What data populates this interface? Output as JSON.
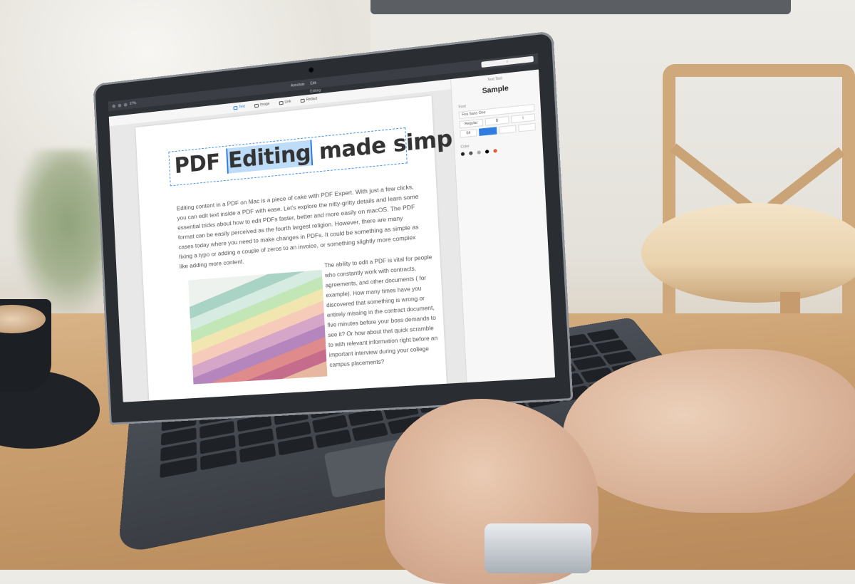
{
  "app": {
    "titlebar": {
      "zoom": "27%",
      "center_items": [
        "Annotate",
        "Edit"
      ],
      "search_placeholder": ""
    },
    "document_title": "Editing",
    "toolbar": {
      "tools": [
        {
          "label": "Text",
          "active": true
        },
        {
          "label": "Image",
          "active": false
        },
        {
          "label": "Link",
          "active": false
        },
        {
          "label": "Redact",
          "active": false
        }
      ]
    },
    "page": {
      "headline_before": "PDF ",
      "headline_selected": "Editing",
      "headline_after": " made simple",
      "body": "Editing content in a PDF on Mac is a piece of cake with PDF Expert. With just a few clicks, you can edit text inside a PDF with ease. Let’s explore the nitty-gritty details and learn some essential tricks about how to edit PDFs faster, better and more easily on macOS. The PDF format can be easily perceived as the fourth largest religion. However, there are many cases today where you need to make changes in PDFs. It could be something as simple as fixing a typo or adding a couple of zeros to an invoice, or something slightly more complex like adding more content.",
      "side_text": "The ability to edit a PDF is vital for people who constantly work with contracts, agreements, and other documents ( for example). How many times have you discovered that something is wrong or entirely missing in the contract document, five minutes before your boss demands to see it? Or how about that quick scramble to  with relevant information right before an important interview during your college campus placements?"
    },
    "inspector": {
      "header": "Text Tool",
      "sample": "Sample",
      "font_label": "Font",
      "font_value": "Fira Sans One",
      "style_value": "Regular",
      "size_value": "64",
      "color_label": "Color",
      "swatches": [
        "#222222",
        "#555555",
        "#aaaaaa",
        "#000000",
        "#e05a3a"
      ]
    }
  }
}
